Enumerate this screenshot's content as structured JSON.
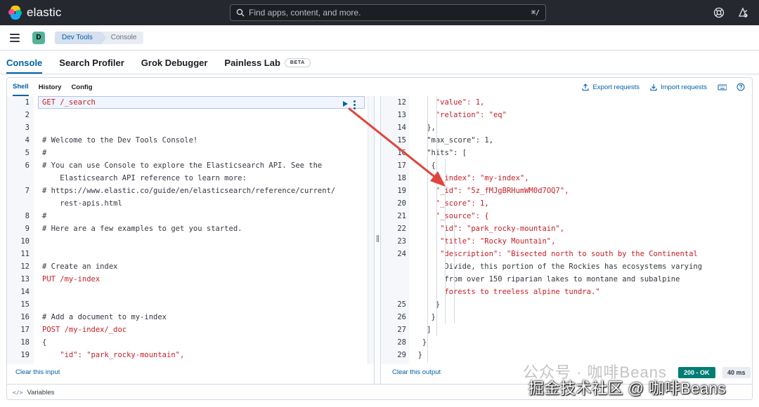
{
  "header": {
    "brand": "elastic",
    "search_placeholder": "Find apps, content, and more.",
    "search_shortcut": "⌘/"
  },
  "breadcrumb": {
    "space_initial": "D",
    "items": [
      "Dev Tools",
      "Console"
    ]
  },
  "tabs": [
    "Console",
    "Search Profiler",
    "Grok Debugger",
    "Painless Lab"
  ],
  "beta_badge": "BETA",
  "subtabs": [
    "Shell",
    "History",
    "Config"
  ],
  "actions": {
    "export": "Export requests",
    "import": "Import requests"
  },
  "editor": {
    "lines": [
      {
        "n": "1",
        "text": "GET /_search"
      },
      {
        "n": "2",
        "text": ""
      },
      {
        "n": "3",
        "text": ""
      },
      {
        "n": "4",
        "text": "# Welcome to the Dev Tools Console!"
      },
      {
        "n": "5",
        "text": "#"
      },
      {
        "n": "6",
        "text": "# You can use Console to explore the Elasticsearch API. See the"
      },
      {
        "n": "",
        "text": "    Elasticsearch API reference to learn more:"
      },
      {
        "n": "7",
        "text": "# https://www.elastic.co/guide/en/elasticsearch/reference/current/"
      },
      {
        "n": "",
        "text": "    rest-apis.html"
      },
      {
        "n": "8",
        "text": "#"
      },
      {
        "n": "9",
        "text": "# Here are a few examples to get you started."
      },
      {
        "n": "10",
        "text": ""
      },
      {
        "n": "11",
        "text": ""
      },
      {
        "n": "12",
        "text": "# Create an index"
      },
      {
        "n": "13",
        "text": "PUT /my-index"
      },
      {
        "n": "14",
        "text": ""
      },
      {
        "n": "15",
        "text": ""
      },
      {
        "n": "16",
        "text": "# Add a document to my-index"
      },
      {
        "n": "17",
        "text": "POST /my-index/_doc"
      },
      {
        "n": "18",
        "text": "{"
      },
      {
        "n": "19",
        "text": "    \"id\": \"park_rocky-mountain\","
      }
    ]
  },
  "output": {
    "lines": [
      {
        "n": "12",
        "indent": 6,
        "text": "\"value\": 1,"
      },
      {
        "n": "13",
        "indent": 6,
        "text": "\"relation\": \"eq\""
      },
      {
        "n": "14",
        "indent": 4,
        "text": "},"
      },
      {
        "n": "15",
        "indent": 4,
        "text": "\"max_score\": 1,"
      },
      {
        "n": "16",
        "indent": 4,
        "text": "\"hits\": ["
      },
      {
        "n": "17",
        "indent": 5,
        "text": "{"
      },
      {
        "n": "18",
        "indent": 6,
        "text": "\"_index\": \"my-index\","
      },
      {
        "n": "19",
        "indent": 6,
        "text": "\"_id\": \"5z_fMJgBRHumWM0d7OQ7\","
      },
      {
        "n": "20",
        "indent": 6,
        "text": "\"_score\": 1,"
      },
      {
        "n": "21",
        "indent": 6,
        "text": "\"_source\": {"
      },
      {
        "n": "22",
        "indent": 7,
        "text": "\"id\": \"park_rocky-mountain\","
      },
      {
        "n": "23",
        "indent": 7,
        "text": "\"title\": \"Rocky Mountain\","
      },
      {
        "n": "24",
        "indent": 7,
        "text": "\"description\": \"Bisected north to south by the Continental"
      },
      {
        "n": "",
        "indent": 8,
        "text": "Divide, this portion of the Rockies has ecosystems varying"
      },
      {
        "n": "",
        "indent": 8,
        "text": "from over 150 riparian lakes to montane and subalpine"
      },
      {
        "n": "",
        "indent": 8,
        "text": "forests to treeless alpine tundra.\""
      },
      {
        "n": "25",
        "indent": 6,
        "text": "}"
      },
      {
        "n": "26",
        "indent": 5,
        "text": "}"
      },
      {
        "n": "27",
        "indent": 4,
        "text": "]"
      },
      {
        "n": "28",
        "indent": 3,
        "text": "}"
      },
      {
        "n": "29",
        "indent": 2,
        "text": "}"
      }
    ]
  },
  "footer": {
    "clear_input": "Clear this input",
    "clear_output": "Clear this output",
    "status": "200 - OK",
    "timing": "40 ms",
    "variables": "Variables"
  },
  "watermark": {
    "line1": "公众号 · 咖啡Beans",
    "line2": "掘金技术社区 @ 咖啡Beans"
  },
  "colors": {
    "accent": "#0061a6",
    "header_bg": "#25282f",
    "success": "#017d73",
    "code_red": "#c61e25",
    "annotation_arrow": "#e0443a"
  }
}
